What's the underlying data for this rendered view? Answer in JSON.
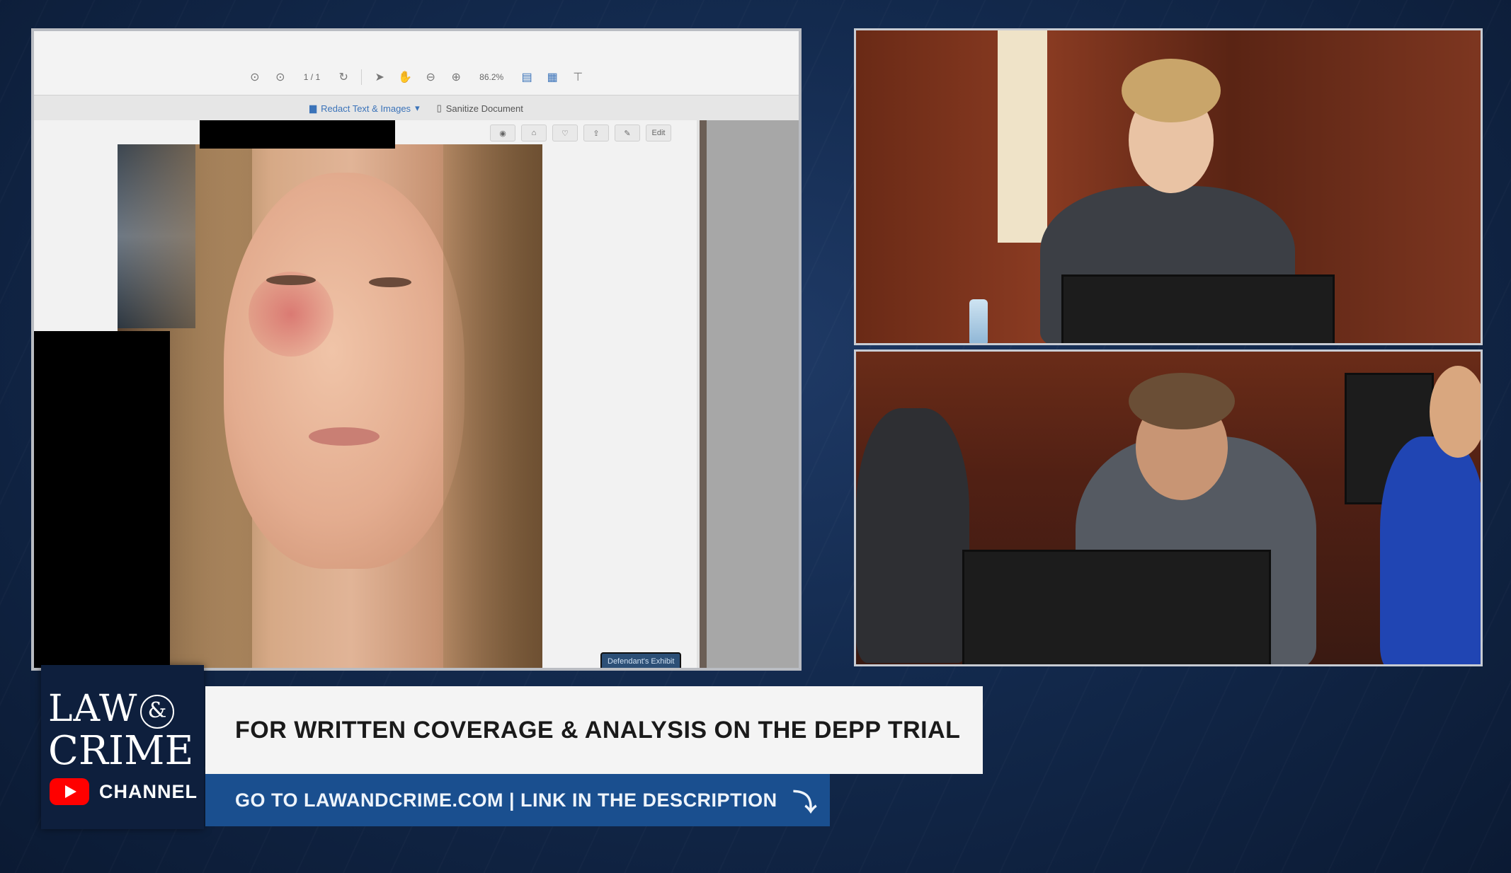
{
  "viewer": {
    "zoom": "86.2%",
    "redact_label": "Redact Text & Images",
    "sanitize_label": "Sanitize Document",
    "page_buttons": [
      "",
      "",
      "",
      "",
      "",
      "Edit"
    ],
    "exhibit_label": "Defendant's Exhibit"
  },
  "logo": {
    "law": "LAW",
    "amp": "&",
    "crime": "CRIME",
    "channel": "CHANNEL"
  },
  "banner": {
    "headline": "FOR WRITTEN COVERAGE & ANALYSIS ON THE DEPP TRIAL",
    "cta": "GO TO LAWANDCRIME.COM | LINK IN THE DESCRIPTION"
  },
  "colors": {
    "background": "#132a4e",
    "cta_blue": "#1a4f8f",
    "youtube_red": "#ff0000"
  }
}
